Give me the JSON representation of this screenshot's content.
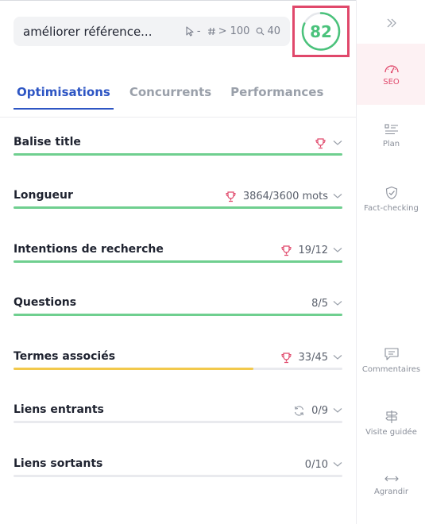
{
  "header": {
    "keyword": "améliorer référence...",
    "stats": [
      {
        "icon": "cursor-icon",
        "value": "-"
      },
      {
        "icon": "hash-icon",
        "value": "> 100"
      },
      {
        "icon": "search-icon",
        "value": "40"
      }
    ],
    "score": "82",
    "score_fraction": 0.82
  },
  "tabs": [
    {
      "label": "Optimisations",
      "active": true
    },
    {
      "label": "Concurrents",
      "active": false
    },
    {
      "label": "Performances",
      "active": false
    }
  ],
  "rows": [
    {
      "title": "Balise title",
      "icon": "trophy-icon",
      "value": "",
      "progress": 1.0,
      "color": "#6fcf8f"
    },
    {
      "title": "Longueur",
      "icon": "trophy-icon",
      "value": "3864/3600 mots",
      "progress": 1.0,
      "color": "#6fcf8f"
    },
    {
      "title": "Intentions de recherche",
      "icon": "trophy-icon",
      "value": "19/12",
      "progress": 1.0,
      "color": "#6fcf8f"
    },
    {
      "title": "Questions",
      "icon": "",
      "value": "8/5",
      "progress": 1.0,
      "color": "#6fcf8f"
    },
    {
      "title": "Termes associés",
      "icon": "trophy-icon",
      "value": "33/45",
      "progress": 0.73,
      "color": "#f2c94c"
    },
    {
      "title": "Liens entrants",
      "icon": "refresh-icon",
      "value": "0/9",
      "progress": 0.0,
      "color": "#6fcf8f"
    },
    {
      "title": "Liens sortants",
      "icon": "",
      "value": "0/10",
      "progress": 0.0,
      "color": "#6fcf8f"
    }
  ],
  "sidebar": {
    "collapse_icon": "double-chevron-right-icon",
    "items": [
      {
        "label": "SEO",
        "icon": "gauge-icon",
        "active": true
      },
      {
        "label": "Plan",
        "icon": "outline-icon",
        "active": false
      },
      {
        "label": "Fact-checking",
        "icon": "shield-check-icon",
        "active": false
      },
      {
        "label": "Commentaires",
        "icon": "comment-icon",
        "active": false
      },
      {
        "label": "Visite guidée",
        "icon": "signpost-icon",
        "active": false
      },
      {
        "label": "Agrandir",
        "icon": "expand-arrows-icon",
        "active": false
      }
    ]
  },
  "colors": {
    "accent_blue": "#2e56c4",
    "accent_red": "#e0486b",
    "success_green": "#4ac27b",
    "warning_yellow": "#f2c94c"
  }
}
